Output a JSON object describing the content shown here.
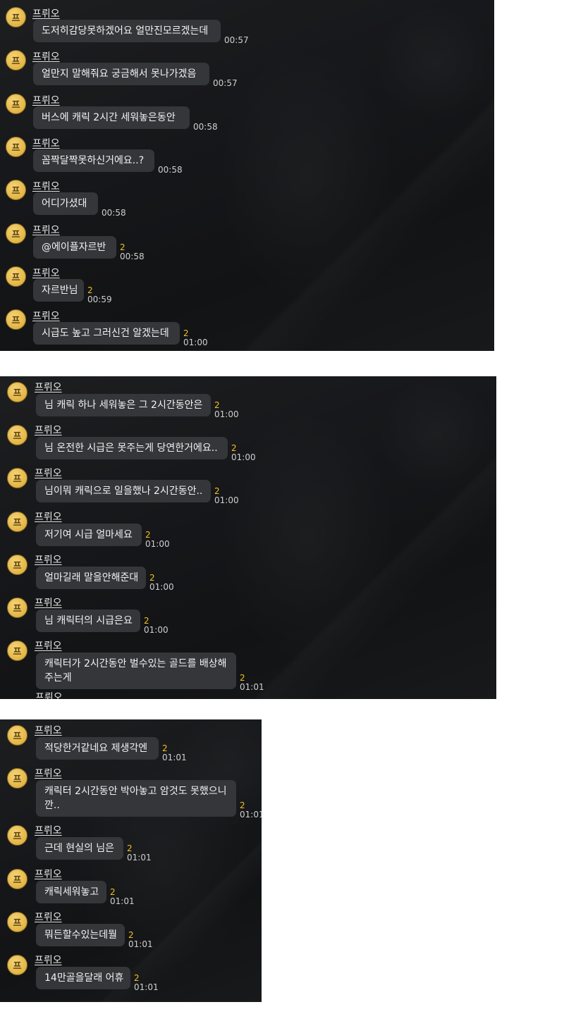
{
  "sender_name": "프뤼오",
  "avatar_glyph": "프",
  "panel1": [
    {
      "text": "도저히감당못하겠어요 얼만진모르겠는데",
      "unread": "",
      "time": "00:57"
    },
    {
      "text": "얼만지 말해줘요 궁금해서 못나가겠음",
      "unread": "",
      "time": "00:57"
    },
    {
      "text": "버스에 캐릭  2시간 세워놓은동안",
      "unread": "",
      "time": "00:58"
    },
    {
      "text": "꼼짝달짝못하신거에요..?",
      "unread": "",
      "time": "00:58"
    },
    {
      "text": "어디가셨대",
      "unread": "",
      "time": "00:58"
    },
    {
      "text": "@에이플자르반",
      "unread": "2",
      "time": "00:58"
    },
    {
      "text": "자르반님",
      "unread": "2",
      "time": "00:59"
    },
    {
      "text": "시급도 높고 그러신건 알겠는데",
      "unread": "2",
      "time": "01:00"
    }
  ],
  "panel2": [
    {
      "text": "님 캐릭 하나 세워놓은 그 2시간동안은",
      "unread": "2",
      "time": "01:00"
    },
    {
      "text": "님 온전한 시급은 못주는게 당연한거에요..",
      "unread": "2",
      "time": "01:00"
    },
    {
      "text": "님이뭐 캐릭으로 일을했나 2시간동안..",
      "unread": "2",
      "time": "01:00"
    },
    {
      "text": "저기여 시급 얼마세요",
      "unread": "2",
      "time": "01:00"
    },
    {
      "text": "얼마길래 말을안해준대",
      "unread": "2",
      "time": "01:00"
    },
    {
      "text": "님 캐릭터의 시급은요",
      "unread": "2",
      "time": "01:00"
    },
    {
      "text": "캐릭터가 2시간동안 벌수있는 골드를 배상해 주는게",
      "unread": "2",
      "time": "01:01"
    }
  ],
  "panel2_partial_name": "프뤼오",
  "panel3": [
    {
      "text": "적당한거같네요 제생각엔",
      "unread": "2",
      "time": "01:01"
    },
    {
      "text": "캐릭터 2시간동안 박아놓고 암것도 못했으니 깐..",
      "unread": "2",
      "time": "01:01"
    },
    {
      "text": "근데 현실의 님은",
      "unread": "2",
      "time": "01:01"
    },
    {
      "text": "캐릭세워놓고",
      "unread": "2",
      "time": "01:01"
    },
    {
      "text": "뭐든할수있는데뭘",
      "unread": "2",
      "time": "01:01"
    },
    {
      "text": "14만골을달래 어휴",
      "unread": "2",
      "time": "01:01"
    }
  ]
}
